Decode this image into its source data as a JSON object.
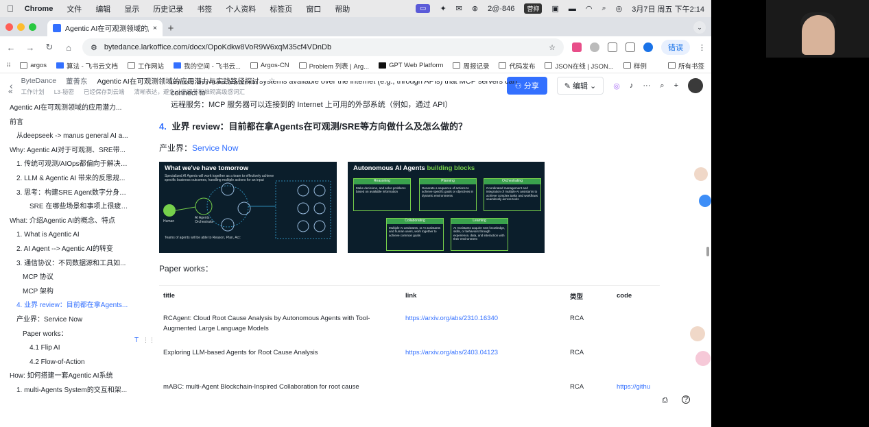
{
  "menubar": {
    "app": "Chrome",
    "items": [
      "文件",
      "编辑",
      "显示",
      "历史记录",
      "书签",
      "个人资料",
      "标签页",
      "窗口",
      "帮助"
    ],
    "status": {
      "counter": "2@·846",
      "badge": "营抑",
      "datetime": "3月7日 周五 下午2:14"
    }
  },
  "tab": {
    "title": "Agentic AI在可观测领域的应用"
  },
  "address": {
    "url": "bytedance.larkoffice.com/docx/OpoKdkw8VoR9W6xqM35cf4VDnDb",
    "error_label": "错误"
  },
  "bookmarks": [
    "argos",
    "算法 - 飞书云文档",
    "工作网站",
    "我的空间 - 飞书云...",
    "Argos-CN",
    "Problem 列表 | Arg...",
    "GPT Web Platform",
    "周报记录",
    "代码发布",
    "JSON在线 | JSON...",
    "样例"
  ],
  "bookmarks_right": "所有书签",
  "doc_header": {
    "crumbs": [
      "ByteDance",
      "董善东",
      "Agentic AI在可观测领域的应用潜力与实践路径探讨"
    ],
    "meta": [
      "工作计划",
      "L3-秘密",
      "已经保存到云端",
      "清晰表达，避免过度细节和堆砌高级感词汇"
    ],
    "share": "分享",
    "edit": "编辑"
  },
  "toc": [
    {
      "text": "Agentic AI在可观测领域的应用潜力...",
      "level": 0
    },
    {
      "text": "前言",
      "level": 0
    },
    {
      "text": "从deepseek -> manus general AI a...",
      "level": 1
    },
    {
      "text": "Why: Agentic AI对于可观测、SRE带...",
      "level": 0
    },
    {
      "text": "1. 传统可观测/AIOps都偏向于解决单...",
      "level": 1
    },
    {
      "text": "2. LLM & Agentic AI 带来的反思规...",
      "level": 1
    },
    {
      "text": "3. 思考：构建SRE Agent数字分身、...",
      "level": 1
    },
    {
      "text": "SRE 在哪些场景和事项上很疲惫...",
      "level": 3
    },
    {
      "text": "What: 介绍Agentic AI的概念、特点",
      "level": 0
    },
    {
      "text": "1. What is Agentic AI",
      "level": 1
    },
    {
      "text": "2. AI Agent --> Agentic AI的转变",
      "level": 1
    },
    {
      "text": "3. 通信协议：不同数据源和工具如...",
      "level": 1
    },
    {
      "text": "MCP 协议",
      "level": 2
    },
    {
      "text": "MCP 架构",
      "level": 2
    },
    {
      "text": "4. 业界 review：目前都在拿Agents...",
      "level": 1,
      "active": true
    },
    {
      "text": "产业界：Service Now",
      "level": 1
    },
    {
      "text": "Paper works：",
      "level": 2
    },
    {
      "text": "4.1 Flip AI",
      "level": 3
    },
    {
      "text": "4.2 Flow-of-Action",
      "level": 3
    },
    {
      "text": "How: 如何搭建一套Agentic AI系统",
      "level": 0
    },
    {
      "text": "1. multi-Agents System的交互和架...",
      "level": 1
    }
  ],
  "content": {
    "line1": "remote Services: External systems available over the internet (e.g., through APIs) that MCP servers can",
    "line2": "connect to",
    "line3": "远程服务：MCP 服务器可以连接到的 Internet 上可用的外部系统（例如，通过 API）",
    "heading_num": "4.",
    "heading_text": "业界 review：目前都在拿Agents在可观测/SRE等方向做什么及怎么做的？",
    "industry_label": "产业界：",
    "industry_link": "Service Now",
    "fig1": {
      "title": "What we've have tomorrow",
      "subtitle": "Specialized AI Agents will work together as a team to effectively achieve specific business outcomes, handling multiple actions for an input",
      "human": "Human",
      "orchestrator": "AI Agents Orchestrator",
      "footer": "Teams of agents will be able to Reason, Plan, Act:"
    },
    "fig2": {
      "title_a": "Autonomous AI Agents",
      "title_b": "building blocks",
      "blocks": [
        {
          "title": "Reasoning",
          "text": "Make decisions, and solve problems based on available information"
        },
        {
          "title": "Planning",
          "text": "Generate a sequence of actions to achieve specific goals or objectives in dynamic environments"
        },
        {
          "title": "Orchestrating",
          "text": "Coordinated management and integration of multiple AI assistants to achieve complex tasks and workflows seamlessly across tools"
        },
        {
          "title": "Collaborating",
          "text": "Multiple AI assistants, or AI assistants and human users, work together to achieve common goals"
        },
        {
          "title": "Learning",
          "text": "AI Assistants acquire new knowledge, skills, or behaviors through experience, data, and interaction with their environment"
        }
      ]
    },
    "paper_label": "Paper works：",
    "table": {
      "headers": [
        "title",
        "link",
        "类型",
        "code"
      ],
      "rows": [
        {
          "title": "RCAgent: Cloud Root Cause Analysis by Autonomous Agents with Tool-Augmented Large Language Models",
          "link": "https://arxiv.org/abs/2310.16340",
          "type": "RCA",
          "code": ""
        },
        {
          "title": "Exploring LLM-based Agents for Root Cause Analysis",
          "link": "https://arxiv.org/abs/2403.04123",
          "type": "RCA",
          "code": ""
        },
        {
          "title": "mABC: multi-Agent Blockchain-Inspired Collaboration for root cause",
          "link": "",
          "type": "RCA",
          "code": "https://githu"
        }
      ]
    }
  }
}
